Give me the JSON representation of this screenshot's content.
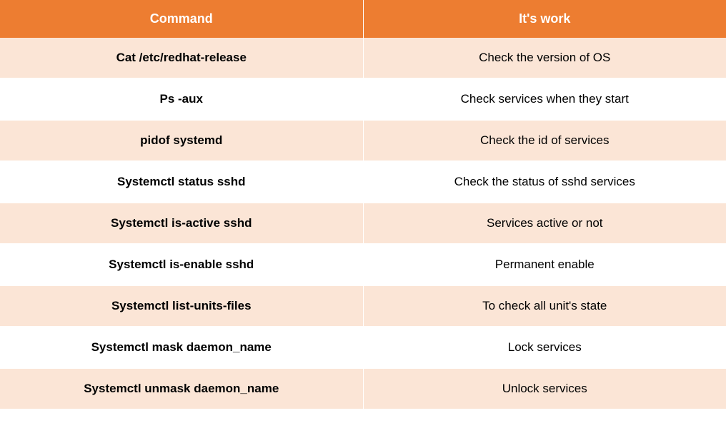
{
  "table": {
    "headers": {
      "command": "Command",
      "work": "It's work"
    },
    "rows": [
      {
        "command": "Cat /etc/redhat-release",
        "work": "Check the version of OS"
      },
      {
        "command": "Ps -aux",
        "work": "Check services when they start"
      },
      {
        "command": "pidof systemd",
        "work": "Check the id of services"
      },
      {
        "command": "Systemctl status sshd",
        "work": "Check the status of sshd services"
      },
      {
        "command": "Systemctl is-active sshd",
        "work": "Services active or not"
      },
      {
        "command": "Systemctl is-enable sshd",
        "work": "Permanent enable"
      },
      {
        "command": "Systemctl list-units-files",
        "work": "To check all unit's state"
      },
      {
        "command": "Systemctl mask daemon_name",
        "work": "Lock services"
      },
      {
        "command": "Systemctl unmask daemon_name",
        "work": "Unlock services"
      }
    ]
  }
}
